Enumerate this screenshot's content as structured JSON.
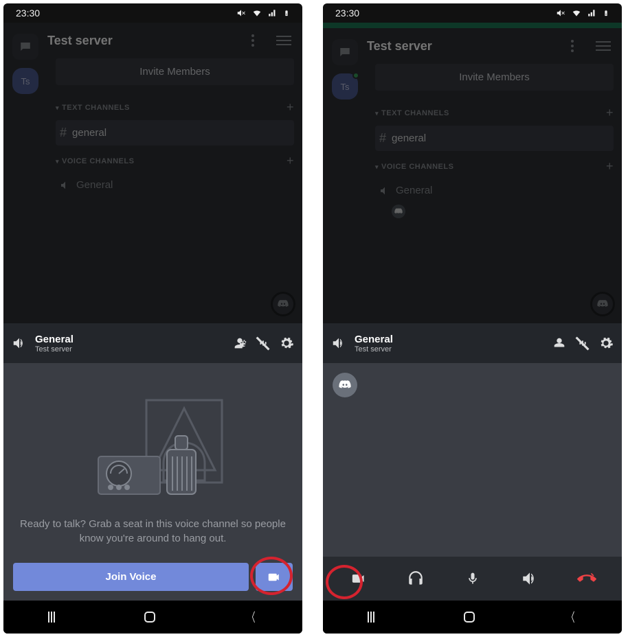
{
  "statusbar": {
    "time": "23:30"
  },
  "server": {
    "title": "Test server",
    "avatar_label": "Ts",
    "invite_label": "Invite Members",
    "cat_text": "TEXT CHANNELS",
    "cat_voice": "VOICE CHANNELS",
    "channel_text": "general",
    "channel_voice": "General"
  },
  "voice": {
    "title": "General",
    "subtitle": "Test server",
    "prompt": "Ready to talk? Grab a seat in this voice channel so people know you're around to hang out.",
    "join_label": "Join Voice"
  }
}
